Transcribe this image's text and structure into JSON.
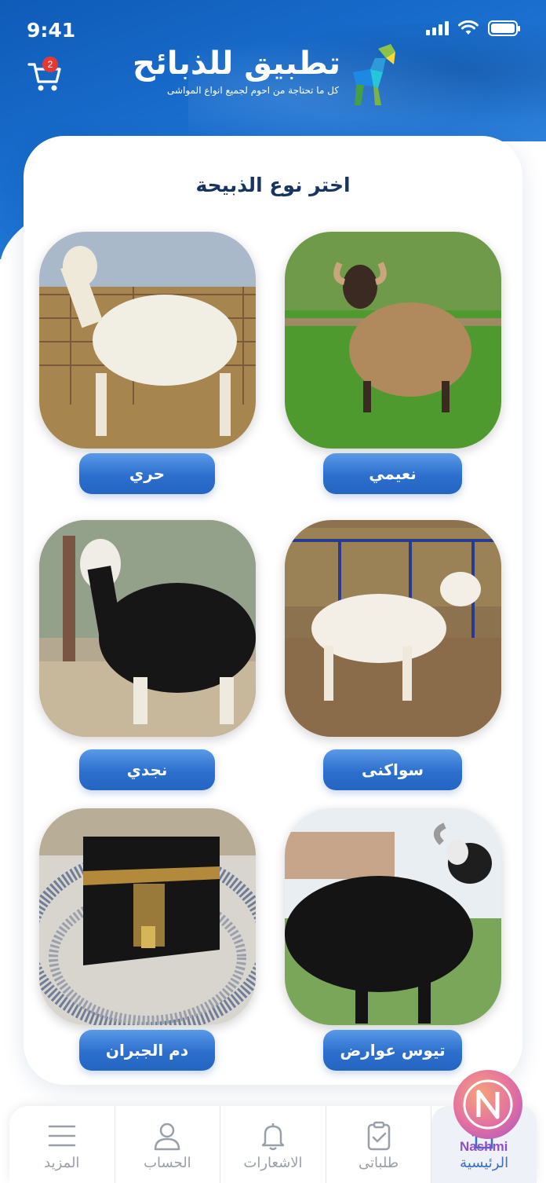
{
  "status_bar": {
    "time": "9:41"
  },
  "header": {
    "app_title": "تطبيق للذبائح",
    "app_subtitle": "كل ما تحتاجة من احوم لجميع انواع المواشى",
    "cart_count": "2",
    "cart_icon": "cart-icon"
  },
  "main": {
    "title": "اختر نوع الذبيحة",
    "items": [
      {
        "label": "نعيمي",
        "image": "brown-woolly-sheep-on-grass"
      },
      {
        "label": "حري",
        "image": "white-sheep-in-pen"
      },
      {
        "label": "سواكنى",
        "image": "white-sheep-walking-by-hay"
      },
      {
        "label": "نجدي",
        "image": "black-sheep-white-head"
      },
      {
        "label": "تيوس عوارض",
        "image": "black-goat-on-grass"
      },
      {
        "label": "دم الجبران",
        "image": "kaaba-with-pilgrims"
      }
    ]
  },
  "bottom_nav": {
    "items": [
      {
        "label": "المزيد",
        "icon": "menu-icon"
      },
      {
        "label": "الحساب",
        "icon": "user-icon"
      },
      {
        "label": "الاشعارات",
        "icon": "bell-icon"
      },
      {
        "label": "طلباتى",
        "icon": "clipboard-check-icon"
      },
      {
        "label": "الرئيسية",
        "icon": "home-icon",
        "active": true
      }
    ]
  },
  "watermark": {
    "text": "Nashmi"
  },
  "colors": {
    "primary": "#1a6fcf",
    "title": "#18355f",
    "pill": "#2c6fcd",
    "badge": "#e53935"
  }
}
